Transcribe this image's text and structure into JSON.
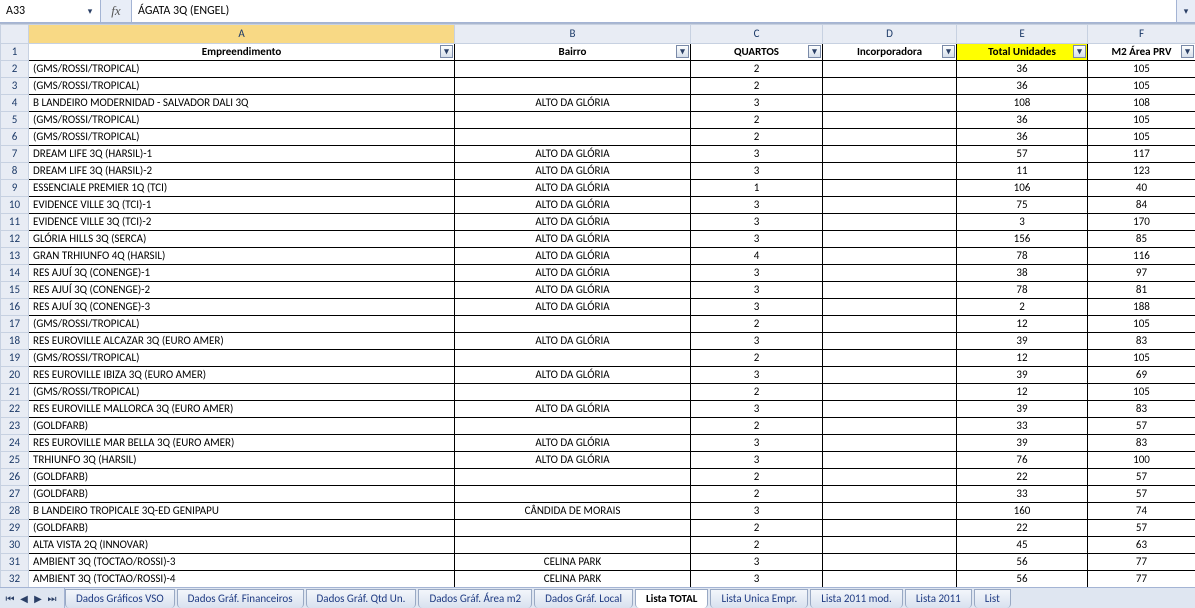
{
  "formulaBar": {
    "cellRef": "A33",
    "fxLabel": "fx",
    "formula": "ÁGATA 3Q (ENGEL)"
  },
  "columns": {
    "letters": [
      "A",
      "B",
      "C",
      "D",
      "E",
      "F"
    ],
    "headers": [
      {
        "label": "Empreendimento",
        "highlight": false
      },
      {
        "label": "Bairro",
        "highlight": false
      },
      {
        "label": "QUARTOS",
        "highlight": false
      },
      {
        "label": "Incorporadora",
        "highlight": false
      },
      {
        "label": "Total Unidades",
        "highlight": true
      },
      {
        "label": "M2 Área PRV",
        "highlight": false
      }
    ],
    "selected": 0
  },
  "rows": [
    {
      "n": 2,
      "A": "(GMS/ROSSI/TROPICAL)",
      "B": "",
      "C": "2",
      "D": "",
      "E": "36",
      "F": "105"
    },
    {
      "n": 3,
      "A": "(GMS/ROSSI/TROPICAL)",
      "B": "",
      "C": "2",
      "D": "",
      "E": "36",
      "F": "105"
    },
    {
      "n": 4,
      "A": "B LANDEIRO MODERNIDAD - SALVADOR DALI 3Q",
      "B": "ALTO DA GLÓRIA",
      "C": "3",
      "D": "",
      "E": "108",
      "F": "108"
    },
    {
      "n": 5,
      "A": "(GMS/ROSSI/TROPICAL)",
      "B": "",
      "C": "2",
      "D": "",
      "E": "36",
      "F": "105"
    },
    {
      "n": 6,
      "A": "(GMS/ROSSI/TROPICAL)",
      "B": "",
      "C": "2",
      "D": "",
      "E": "36",
      "F": "105"
    },
    {
      "n": 7,
      "A": "DREAM LIFE 3Q (HARSIL)-1",
      "B": "ALTO DA GLÓRIA",
      "C": "3",
      "D": "",
      "E": "57",
      "F": "117"
    },
    {
      "n": 8,
      "A": "DREAM LIFE 3Q (HARSIL)-2",
      "B": "ALTO DA GLÓRIA",
      "C": "3",
      "D": "",
      "E": "11",
      "F": "123"
    },
    {
      "n": 9,
      "A": "ESSENCIALE PREMIER 1Q (TCI)",
      "B": "ALTO DA GLÓRIA",
      "C": "1",
      "D": "",
      "E": "106",
      "F": "40"
    },
    {
      "n": 10,
      "A": "EVIDENCE VILLE 3Q (TCI)-1",
      "B": "ALTO DA GLÓRIA",
      "C": "3",
      "D": "",
      "E": "75",
      "F": "84"
    },
    {
      "n": 11,
      "A": "EVIDENCE VILLE 3Q (TCI)-2",
      "B": "ALTO DA GLÓRIA",
      "C": "3",
      "D": "",
      "E": "3",
      "F": "170"
    },
    {
      "n": 12,
      "A": "GLÓRIA HILLS 3Q (SERCA)",
      "B": "ALTO DA GLÓRIA",
      "C": "3",
      "D": "",
      "E": "156",
      "F": "85"
    },
    {
      "n": 13,
      "A": "GRAN TRHIUNFO 4Q (HARSIL)",
      "B": "ALTO DA GLÓRIA",
      "C": "4",
      "D": "",
      "E": "78",
      "F": "116"
    },
    {
      "n": 14,
      "A": "RES AJUÍ 3Q (CONENGE)-1",
      "B": "ALTO DA GLÓRIA",
      "C": "3",
      "D": "",
      "E": "38",
      "F": "97"
    },
    {
      "n": 15,
      "A": "RES AJUÍ 3Q (CONENGE)-2",
      "B": "ALTO DA GLÓRIA",
      "C": "3",
      "D": "",
      "E": "78",
      "F": "81"
    },
    {
      "n": 16,
      "A": "RES AJUÍ 3Q (CONENGE)-3",
      "B": "ALTO DA GLÓRIA",
      "C": "3",
      "D": "",
      "E": "2",
      "F": "188"
    },
    {
      "n": 17,
      "A": "(GMS/ROSSI/TROPICAL)",
      "B": "",
      "C": "2",
      "D": "",
      "E": "12",
      "F": "105"
    },
    {
      "n": 18,
      "A": "RES EUROVILLE ALCAZAR 3Q (EURO AMER)",
      "B": "ALTO DA GLÓRIA",
      "C": "3",
      "D": "",
      "E": "39",
      "F": "83"
    },
    {
      "n": 19,
      "A": "(GMS/ROSSI/TROPICAL)",
      "B": "",
      "C": "2",
      "D": "",
      "E": "12",
      "F": "105"
    },
    {
      "n": 20,
      "A": "RES EUROVILLE IBIZA 3Q (EURO AMER)",
      "B": "ALTO DA GLÓRIA",
      "C": "3",
      "D": "",
      "E": "39",
      "F": "69"
    },
    {
      "n": 21,
      "A": "(GMS/ROSSI/TROPICAL)",
      "B": "",
      "C": "2",
      "D": "",
      "E": "12",
      "F": "105"
    },
    {
      "n": 22,
      "A": "RES EUROVILLE MALLORCA 3Q (EURO AMER)",
      "B": "ALTO DA GLÓRIA",
      "C": "3",
      "D": "",
      "E": "39",
      "F": "83"
    },
    {
      "n": 23,
      "A": "(GOLDFARB)",
      "B": "",
      "C": "2",
      "D": "",
      "E": "33",
      "F": "57"
    },
    {
      "n": 24,
      "A": "RES EUROVILLE MAR BELLA 3Q (EURO AMER)",
      "B": "ALTO DA GLÓRIA",
      "C": "3",
      "D": "",
      "E": "39",
      "F": "83"
    },
    {
      "n": 25,
      "A": "TRHIUNFO 3Q (HARSIL)",
      "B": "ALTO DA GLÓRIA",
      "C": "3",
      "D": "",
      "E": "76",
      "F": "100"
    },
    {
      "n": 26,
      "A": "(GOLDFARB)",
      "B": "",
      "C": "2",
      "D": "",
      "E": "22",
      "F": "57"
    },
    {
      "n": 27,
      "A": "(GOLDFARB)",
      "B": "",
      "C": "2",
      "D": "",
      "E": "33",
      "F": "57"
    },
    {
      "n": 28,
      "A": "B LANDEIRO TROPICALE 3Q-ED GENIPAPU",
      "B": "CÂNDIDA DE MORAIS",
      "C": "3",
      "D": "",
      "E": "160",
      "F": "74"
    },
    {
      "n": 29,
      "A": "(GOLDFARB)",
      "B": "",
      "C": "2",
      "D": "",
      "E": "22",
      "F": "57"
    },
    {
      "n": 30,
      "A": "ALTA VISTA 2Q (INNOVAR)",
      "B": "",
      "C": "2",
      "D": "",
      "E": "45",
      "F": "63"
    },
    {
      "n": 31,
      "A": "AMBIENT 3Q (TOCTAO/ROSSI)-3",
      "B": "CELINA PARK",
      "C": "3",
      "D": "",
      "E": "56",
      "F": "77"
    },
    {
      "n": 32,
      "A": "AMBIENT 3Q (TOCTAO/ROSSI)-4",
      "B": "CELINA PARK",
      "C": "3",
      "D": "",
      "E": "56",
      "F": "77"
    }
  ],
  "tabs": {
    "items": [
      "Dados Gráficos VSO",
      "Dados Gráf. Financeiros",
      "Dados Gráf. Qtd Un.",
      "Dados Gráf. Área m2",
      "Dados Gráf. Local",
      "Lista TOTAL",
      "Lista Unica Empr.",
      "Lista 2011 mod.",
      "Lista 2011",
      "List"
    ],
    "activeIndex": 5
  }
}
